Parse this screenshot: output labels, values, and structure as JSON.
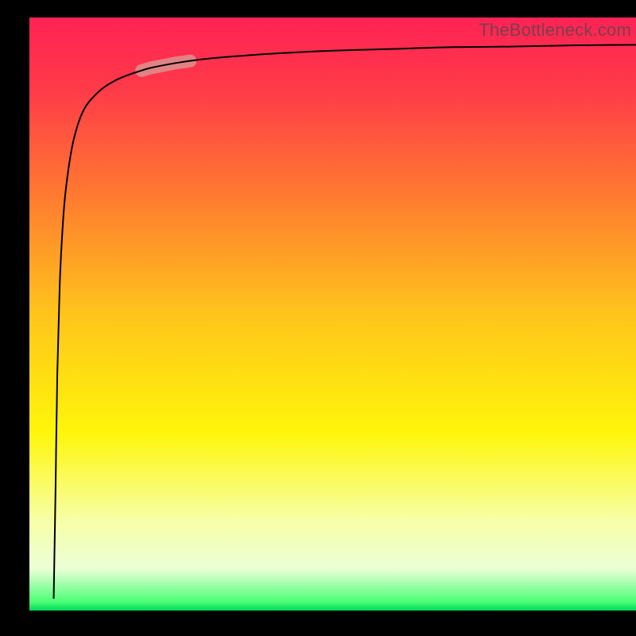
{
  "watermark": "TheBottleneck.com",
  "chart_data": {
    "type": "line",
    "title": "",
    "xlabel": "",
    "ylabel": "",
    "xlim": [
      0,
      100
    ],
    "ylim": [
      0,
      100
    ],
    "grid": false,
    "series": [
      {
        "name": "bottleneck-curve",
        "x": [
          4.0,
          4.3,
          4.6,
          5.0,
          5.5,
          6.0,
          7.0,
          8.0,
          9.0,
          10.0,
          12.0,
          14.0,
          16.0,
          18.0,
          20.0,
          24.0,
          28.0,
          32.0,
          40.0,
          50.0,
          60.0,
          70.0,
          80.0,
          90.0,
          100.0
        ],
        "y": [
          2.0,
          20.0,
          40.0,
          55.0,
          65.0,
          71.0,
          78.0,
          82.0,
          84.5,
          86.0,
          88.0,
          89.3,
          90.2,
          90.9,
          91.5,
          92.3,
          92.9,
          93.3,
          93.9,
          94.4,
          94.7,
          95.0,
          95.1,
          95.3,
          95.4
        ]
      }
    ],
    "annotations": [
      {
        "name": "highlight-segment",
        "type": "pill",
        "x_start": 18.5,
        "x_end": 26.5,
        "color": "#d89a94",
        "opacity": 0.78
      }
    ],
    "background_gradient": {
      "stops": [
        {
          "offset": 0.0,
          "color": "#ff2255"
        },
        {
          "offset": 0.12,
          "color": "#ff3a49"
        },
        {
          "offset": 0.3,
          "color": "#ff7a30"
        },
        {
          "offset": 0.5,
          "color": "#ffc41c"
        },
        {
          "offset": 0.7,
          "color": "#fff60a"
        },
        {
          "offset": 0.85,
          "color": "#f7ffa8"
        },
        {
          "offset": 0.93,
          "color": "#eaffd6"
        },
        {
          "offset": 0.985,
          "color": "#4cff77"
        },
        {
          "offset": 1.0,
          "color": "#00d95a"
        }
      ]
    }
  }
}
